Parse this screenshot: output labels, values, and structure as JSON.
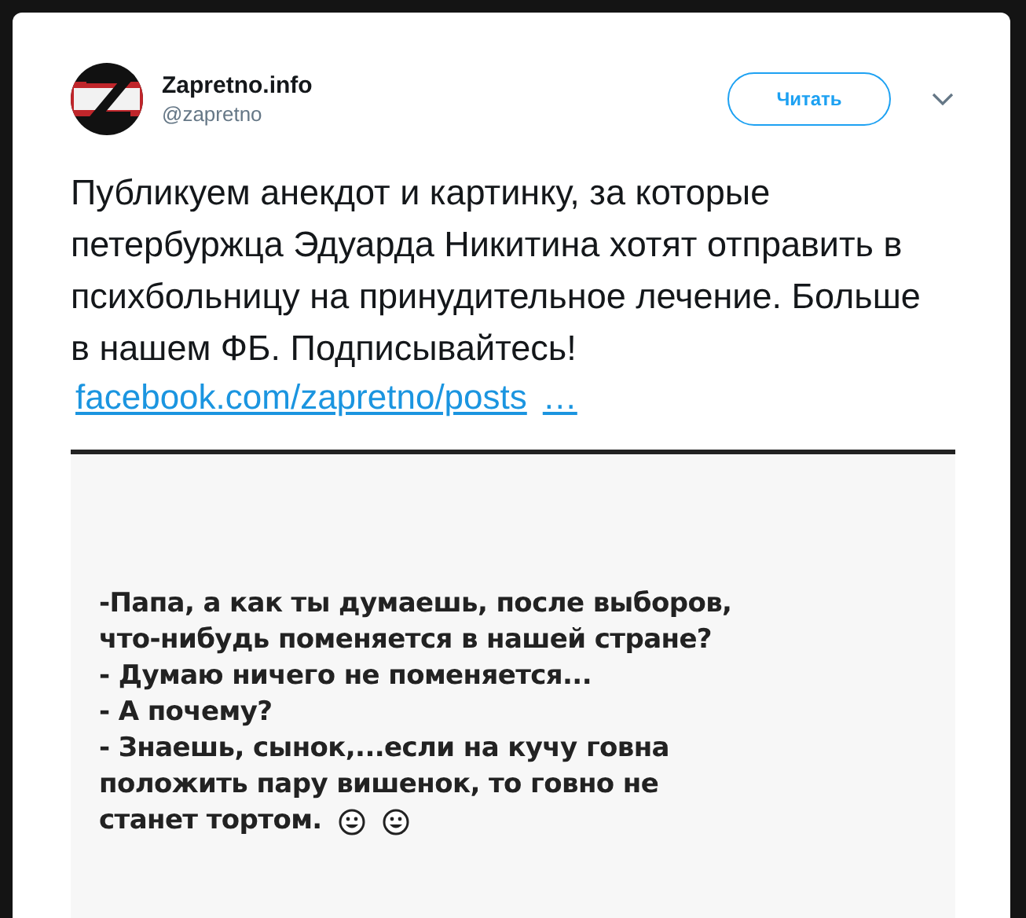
{
  "author": {
    "name": "Zapretno.info",
    "handle": "@zapretno"
  },
  "follow_button": "Читать",
  "tweet_text": "Публикуем анекдот и картинку, за которые петербуржца Эдуарда Никитина хотят отправить в психбольницу на принудительное лечение. Больше в нашем ФБ. Подписывайтесь!",
  "link": "facebook.com/zapretno/posts",
  "link_more": "…",
  "embedded_note": {
    "lines": [
      {
        "text": "-Папа, а как ты думаешь, после выборов,"
      },
      {
        "text": "что-нибудь поменяется в нашей стране?"
      },
      {
        "text": "- Думаю ничего не поменяется..."
      },
      {
        "text": "- А почему?"
      },
      {
        "text": "- Знаешь, сынок,...если на кучу говна"
      },
      {
        "text": "положить пару вишенок, то говно не"
      },
      {
        "text": "станет тортом."
      }
    ],
    "trailing_emojis": [
      {
        "kind": "smiley"
      },
      {
        "kind": "smiley"
      }
    ]
  }
}
